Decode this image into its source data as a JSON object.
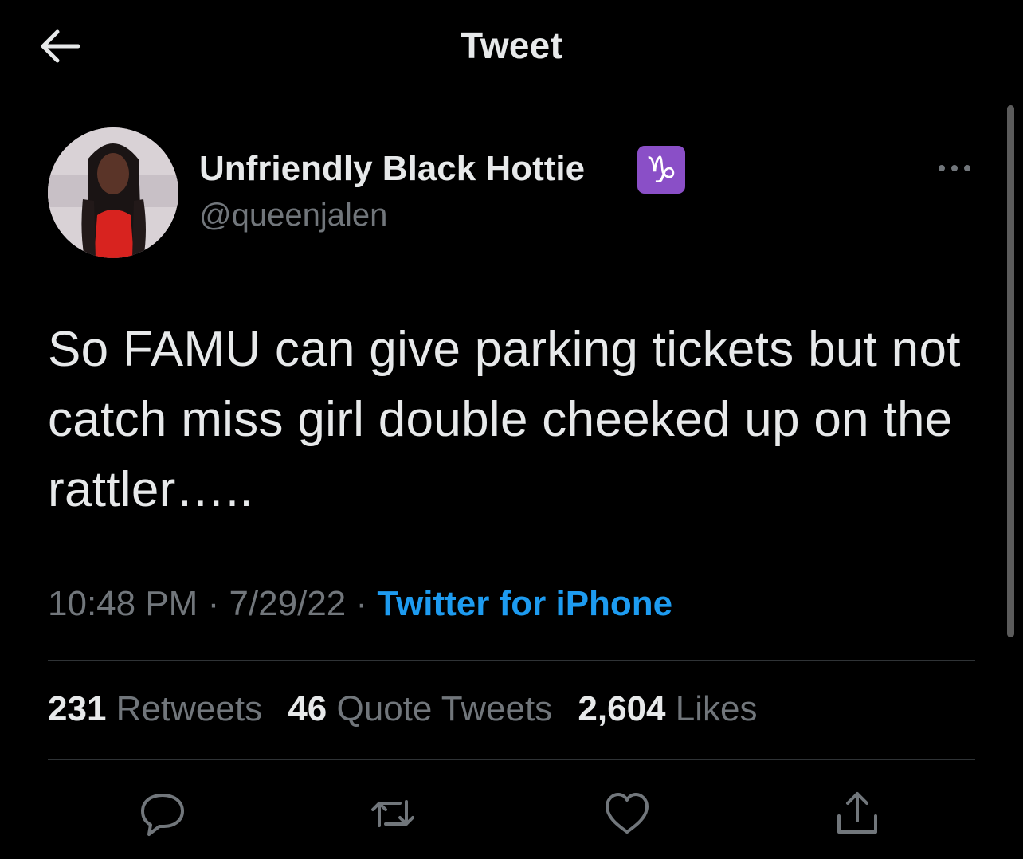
{
  "header": {
    "title": "Tweet",
    "back_icon": "arrow-left-icon"
  },
  "tweet": {
    "author": {
      "name": "Unfriendly Black Hottie",
      "emoji": "♑",
      "handle": "@queenjalen"
    },
    "text": "So FAMU can give parking tickets but not catch miss girl double cheeked up on the rattler…..",
    "time": "10:48 PM",
    "separator": "·",
    "date": "7/29/22",
    "source": "Twitter for iPhone",
    "stats": {
      "retweets_count": "231",
      "retweets_label": "Retweets",
      "quotes_count": "46",
      "quotes_label": "Quote Tweets",
      "likes_count": "2,604",
      "likes_label": "Likes"
    }
  },
  "actions": [
    "reply-icon",
    "retweet-icon",
    "like-icon",
    "share-icon"
  ],
  "colors": {
    "background": "#000000",
    "text": "#e7e9ea",
    "secondary": "#71767b",
    "accent": "#1d9bf0"
  }
}
